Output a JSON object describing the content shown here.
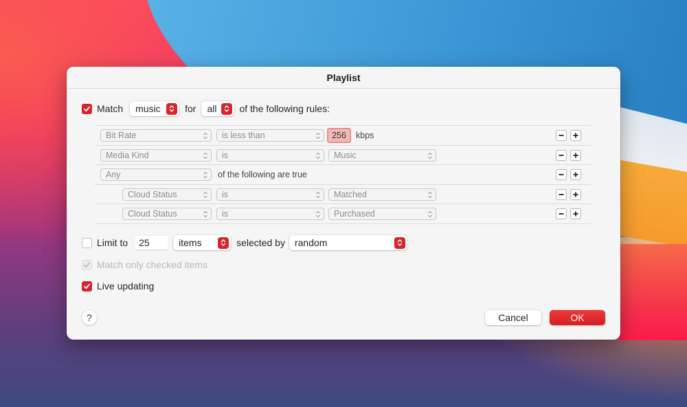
{
  "dialog": {
    "title": "Playlist"
  },
  "match_row": {
    "checked": true,
    "label_match": "Match",
    "kind_value": "music",
    "label_for": "for",
    "scope_value": "all",
    "label_suffix": "of the following rules:"
  },
  "rules": [
    {
      "field": "Bit Rate",
      "operator": "is less than",
      "value": "256",
      "unit": "kbps",
      "indent": false
    },
    {
      "field": "Media Kind",
      "operator": "is",
      "value": "Music",
      "indent": false
    },
    {
      "field": "Any",
      "text": "of the following are true",
      "indent": false
    },
    {
      "field": "Cloud Status",
      "operator": "is",
      "value": "Matched",
      "indent": true
    },
    {
      "field": "Cloud Status",
      "operator": "is",
      "value": "Purchased",
      "indent": true
    }
  ],
  "limit": {
    "checked": false,
    "label": "Limit to",
    "count": "25",
    "unit_value": "items",
    "selected_by_label": "selected by",
    "selected_by_value": "random"
  },
  "match_checked_only": {
    "checked": true,
    "disabled": true,
    "label": "Match only checked items"
  },
  "live_updating": {
    "checked": true,
    "label": "Live updating"
  },
  "buttons": {
    "help": "?",
    "cancel": "Cancel",
    "ok": "OK"
  },
  "colors": {
    "accent": "#d8242d",
    "dialog_bg": "#f5f5f5"
  }
}
